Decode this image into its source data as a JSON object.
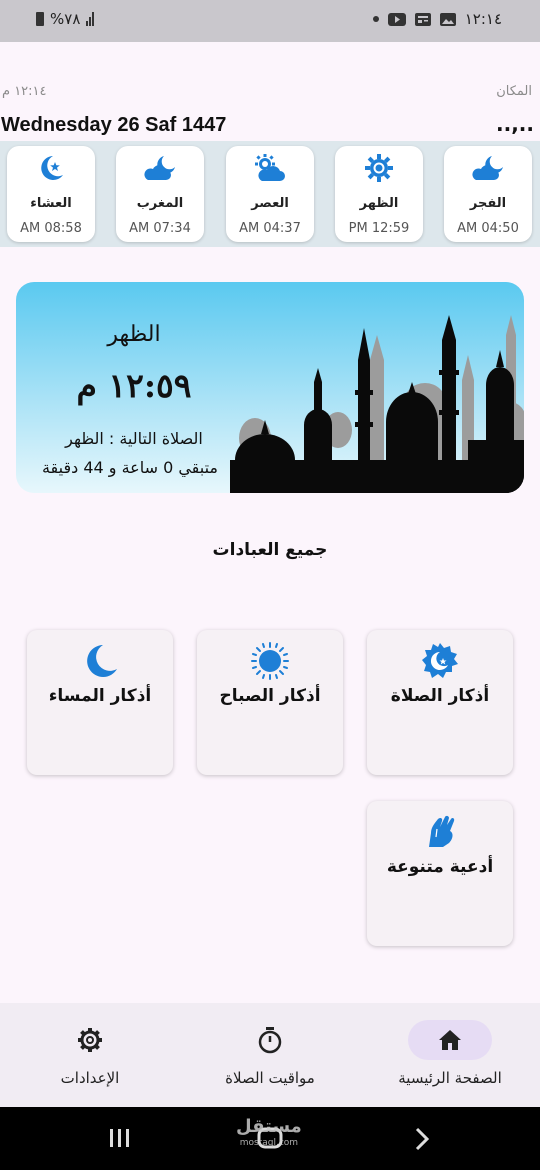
{
  "status_bar": {
    "battery_text": "%٧٨",
    "time": "١٢:١٤"
  },
  "header": {
    "location_label": "المكان",
    "location_name": "..,..",
    "current_time": "١٢:١٤ م",
    "date": "Wednesday 26 Saf 1447"
  },
  "prayers": [
    {
      "name": "الفجر",
      "time": "AM 04:50",
      "icon": "cloud-moon-icon"
    },
    {
      "name": "الظهر",
      "time": "PM 12:59",
      "icon": "sun-gear-icon"
    },
    {
      "name": "العصر",
      "time": "AM 04:37",
      "icon": "sun-cloud-icon"
    },
    {
      "name": "المغرب",
      "time": "AM 07:34",
      "icon": "cloud-moon-icon"
    },
    {
      "name": "العشاء",
      "time": "AM 08:58",
      "icon": "moon-star-icon"
    }
  ],
  "hero": {
    "prayer_name": "الظهر",
    "prayer_time": "١٢:٥٩ م",
    "next_prayer": "الصلاة التالية : الظهر",
    "remaining": "متبقي 0 ساعة و 44 دقيقة"
  },
  "section_title": "جميع العبادات",
  "worship": [
    {
      "label": "أذكار الصلاة",
      "icon": "mosque-badge-icon"
    },
    {
      "label": "أذكار الصباح",
      "icon": "sun-icon"
    },
    {
      "label": "أذكار المساء",
      "icon": "moon-icon"
    },
    {
      "label": "أدعية متنوعة",
      "icon": "praying-hands-icon"
    }
  ],
  "bottom_nav": {
    "home": "الصفحة الرئيسية",
    "prayer_times": "مواقيت الصلاة",
    "settings": "الإعدادات"
  },
  "watermark": {
    "brand": "مستقل",
    "site": "mostaql.com"
  },
  "colors": {
    "accent": "#1e7fd6",
    "card": "#ffffff",
    "strip": "#dde7ec",
    "nav_active": "#e6dcf4"
  }
}
